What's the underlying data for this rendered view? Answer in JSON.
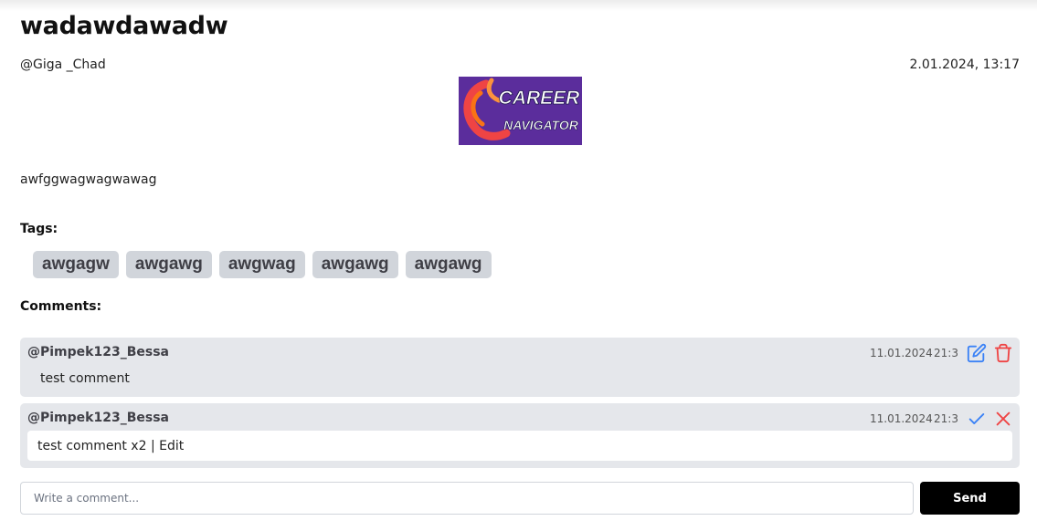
{
  "post": {
    "title": "wadawdawadw",
    "author": "@Giga _Chad",
    "date": "2.01.2024,",
    "time": "13:17",
    "image": {
      "line1": "CAREER",
      "line2": "NAVIGATOR",
      "background": "#5b2d9c",
      "accent": "#ef4444"
    },
    "body": "awfggwagwagwawag"
  },
  "tags": {
    "heading": "Tags:",
    "items": [
      "awgagw",
      "awgawg",
      "awgwag",
      "awgawg",
      "awgawg"
    ]
  },
  "comments": {
    "heading": "Comments:",
    "items": [
      {
        "author": "@Pimpek123_Bessa",
        "date": "11.01.2024",
        "time": "21:3",
        "text": "test comment",
        "icons": [
          "edit-icon",
          "trash-icon"
        ]
      },
      {
        "author": "@Pimpek123_Bessa",
        "date": "11.01.2024",
        "time": "21:3",
        "edit_value": "test comment x2 | Edit",
        "icons": [
          "check-icon",
          "close-icon"
        ]
      }
    ]
  },
  "composer": {
    "placeholder": "Write a comment...",
    "send_label": "Send"
  },
  "colors": {
    "edit_icon": "#3b82f6",
    "delete_icon": "#ef4444",
    "tag_bg": "#d1d5db",
    "comment_bg": "#e5e7eb",
    "send_bg": "#000000"
  }
}
